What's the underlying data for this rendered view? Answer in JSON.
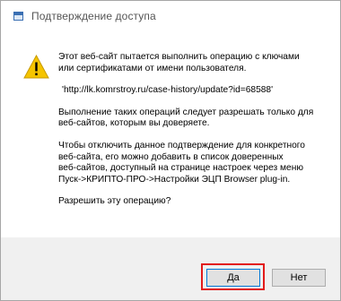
{
  "window": {
    "title": "Подтверждение доступа",
    "icon": "window-icon"
  },
  "content": {
    "icon": "warning-icon",
    "message_1": "Этот веб-сайт пытается выполнить операцию с ключами\nили сертификатами от имени пользователя.",
    "url": "'http://lk.komrstroy.ru/case-history/update?id=68588'",
    "message_2": "Выполнение таких операций следует разрешать только для\nвеб-сайтов, которым вы доверяете.",
    "message_3": "Чтобы отключить данное подтверждение для конкретного\nвеб-сайта, его можно добавить в список доверенных\nвеб-сайтов, доступный на странице настроек через меню\nПуск->КРИПТО-ПРО->Настройки ЭЦП Browser plug-in.",
    "question": "Разрешить эту операцию?"
  },
  "buttons": {
    "yes_label": "Да",
    "no_label": "Нет"
  },
  "colors": {
    "highlight": "#e21b1b",
    "warning_fill": "#f5c400"
  }
}
